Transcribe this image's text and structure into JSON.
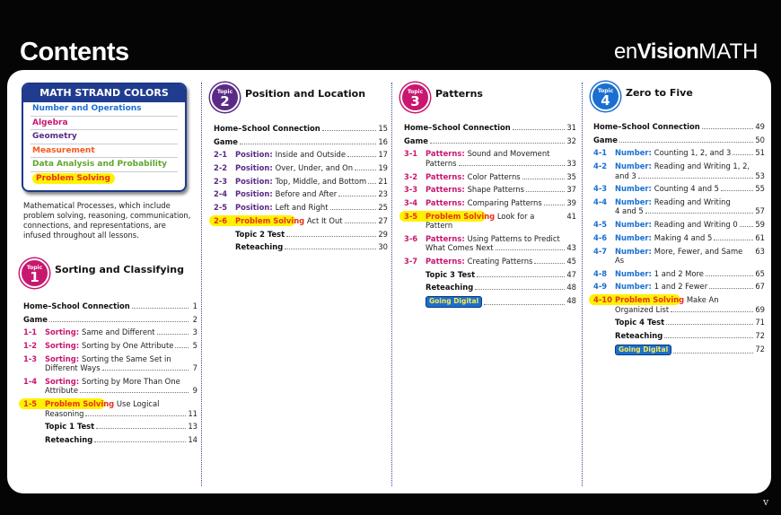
{
  "header": {
    "title": "Contents",
    "logo": "enVisionMATH",
    "page_number": "v"
  },
  "strand_colors": {
    "heading": "MATH STRAND COLORS",
    "items": [
      {
        "label": "Number and Operations",
        "color": "#1a6fd0"
      },
      {
        "label": "Algebra",
        "color": "#c8176f"
      },
      {
        "label": "Geometry",
        "color": "#5b2a86"
      },
      {
        "label": "Measurement",
        "color": "#f2591c"
      },
      {
        "label": "Data Analysis and Probability",
        "color": "#5ea62c"
      },
      {
        "label": "Problem Solving",
        "color": "#e8301c",
        "highlight": "#fff200"
      }
    ]
  },
  "note": "Mathematical Processes, which include problem solving, reasoning, communication, connections, and representations, are infused throughout all lessons.",
  "topics": [
    {
      "label": "Topic",
      "number": "1",
      "title": "Sorting and Classifying",
      "color": "#c8176f",
      "entries": [
        {
          "type": "bold",
          "lines": [
            "Home–School Connection"
          ],
          "page": "1"
        },
        {
          "type": "bold",
          "lines": [
            "Game"
          ],
          "page": "2"
        },
        {
          "num": "1-1",
          "strand": "Sorting:",
          "lines": [
            "Same and Different"
          ],
          "page": "3"
        },
        {
          "num": "1-2",
          "strand": "Sorting:",
          "lines": [
            "Sorting by One Attribute"
          ],
          "page": "5"
        },
        {
          "num": "1-3",
          "strand": "Sorting:",
          "lines": [
            "Sorting the Same Set in",
            "Different Ways"
          ],
          "page": "7"
        },
        {
          "num": "1-4",
          "strand": "Sorting:",
          "lines": [
            "Sorting by More Than One",
            "Attribute"
          ],
          "page": "9"
        },
        {
          "num": "1-5",
          "ps": "Problem Solving",
          "lines": [
            "Use Logical",
            "Reasoning"
          ],
          "page": "11"
        },
        {
          "type": "sub",
          "lines": [
            "Topic 1 Test"
          ],
          "page": "13"
        },
        {
          "type": "sub",
          "lines": [
            "Reteaching"
          ],
          "page": "14"
        }
      ]
    },
    {
      "label": "Topic",
      "number": "2",
      "title": "Position and Location",
      "color": "#5b2a86",
      "entries": [
        {
          "type": "bold",
          "lines": [
            "Home–School Connection"
          ],
          "page": "15"
        },
        {
          "type": "bold",
          "lines": [
            "Game"
          ],
          "page": "16"
        },
        {
          "num": "2-1",
          "strand": "Position:",
          "lines": [
            "Inside and Outside"
          ],
          "page": "17"
        },
        {
          "num": "2-2",
          "strand": "Position:",
          "lines": [
            "Over, Under, and On"
          ],
          "page": "19"
        },
        {
          "num": "2-3",
          "strand": "Position:",
          "lines": [
            "Top, Middle, and Bottom"
          ],
          "page": "21"
        },
        {
          "num": "2-4",
          "strand": "Position:",
          "lines": [
            "Before and After"
          ],
          "page": "23"
        },
        {
          "num": "2-5",
          "strand": "Position:",
          "lines": [
            "Left and Right"
          ],
          "page": "25"
        },
        {
          "num": "2-6",
          "ps": "Problem Solving",
          "lines": [
            "Act It Out"
          ],
          "page": "27"
        },
        {
          "type": "sub",
          "lines": [
            "Topic 2 Test"
          ],
          "page": "29"
        },
        {
          "type": "sub",
          "lines": [
            "Reteaching"
          ],
          "page": "30"
        }
      ]
    },
    {
      "label": "Topic",
      "number": "3",
      "title": "Patterns",
      "color": "#c8176f",
      "entries": [
        {
          "type": "bold",
          "lines": [
            "Home–School Connection"
          ],
          "page": "31"
        },
        {
          "type": "bold",
          "lines": [
            "Game"
          ],
          "page": "32"
        },
        {
          "num": "3-1",
          "strand": "Patterns:",
          "lines": [
            "Sound and Movement",
            "Patterns"
          ],
          "page": "33"
        },
        {
          "num": "3-2",
          "strand": "Patterns:",
          "lines": [
            "Color Patterns"
          ],
          "page": "35"
        },
        {
          "num": "3-3",
          "strand": "Patterns:",
          "lines": [
            "Shape Patterns"
          ],
          "page": "37"
        },
        {
          "num": "3-4",
          "strand": "Patterns:",
          "lines": [
            "Comparing Patterns"
          ],
          "page": "39"
        },
        {
          "num": "3-5",
          "ps": "Problem Solving",
          "lines": [
            "Look for a Pattern"
          ],
          "page": "41"
        },
        {
          "num": "3-6",
          "strand": "Patterns:",
          "lines": [
            "Using Patterns to Predict",
            "What Comes Next"
          ],
          "page": "43"
        },
        {
          "num": "3-7",
          "strand": "Patterns:",
          "lines": [
            "Creating Patterns"
          ],
          "page": "45"
        },
        {
          "type": "sub",
          "lines": [
            "Topic 3 Test"
          ],
          "page": "47"
        },
        {
          "type": "sub",
          "lines": [
            "Reteaching"
          ],
          "page": "48"
        },
        {
          "type": "digital",
          "lines": [
            "Going Digital"
          ],
          "page": "48"
        }
      ]
    },
    {
      "label": "Topic",
      "number": "4",
      "title": "Zero to Five",
      "color": "#1a6fd0",
      "entries": [
        {
          "type": "bold",
          "lines": [
            "Home–School Connection"
          ],
          "page": "49"
        },
        {
          "type": "bold",
          "lines": [
            "Game"
          ],
          "page": "50"
        },
        {
          "num": "4-1",
          "strand": "Number:",
          "lines": [
            "Counting 1, 2, and 3"
          ],
          "page": "51"
        },
        {
          "num": "4-2",
          "strand": "Number:",
          "lines": [
            "Reading and Writing 1, 2,",
            "and 3"
          ],
          "page": "53"
        },
        {
          "num": "4-3",
          "strand": "Number:",
          "lines": [
            "Counting 4 and 5"
          ],
          "page": "55"
        },
        {
          "num": "4-4",
          "strand": "Number:",
          "lines": [
            "Reading and Writing",
            "4 and 5"
          ],
          "page": "57"
        },
        {
          "num": "4-5",
          "strand": "Number:",
          "lines": [
            "Reading and Writing 0"
          ],
          "page": "59"
        },
        {
          "num": "4-6",
          "strand": "Number:",
          "lines": [
            "Making 4 and 5"
          ],
          "page": "61"
        },
        {
          "num": "4-7",
          "strand": "Number:",
          "lines": [
            "More, Fewer, and Same As"
          ],
          "page": "63"
        },
        {
          "num": "4-8",
          "strand": "Number:",
          "lines": [
            "1 and 2 More"
          ],
          "page": "65"
        },
        {
          "num": "4-9",
          "strand": "Number:",
          "lines": [
            "1 and 2 Fewer"
          ],
          "page": "67"
        },
        {
          "num": "4-10",
          "ps": "Problem Solving",
          "lines": [
            "Make An",
            "Organized List"
          ],
          "page": "69"
        },
        {
          "type": "sub",
          "lines": [
            "Topic 4 Test"
          ],
          "page": "71"
        },
        {
          "type": "sub",
          "lines": [
            "Reteaching"
          ],
          "page": "72"
        },
        {
          "type": "digital",
          "lines": [
            "Going Digital"
          ],
          "page": "72"
        }
      ]
    }
  ]
}
